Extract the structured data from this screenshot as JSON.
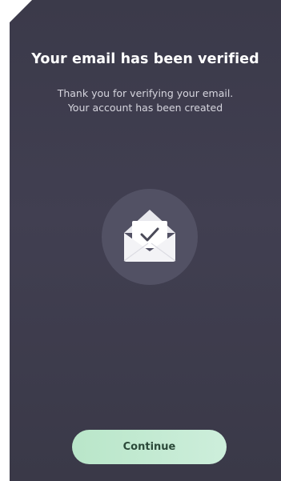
{
  "screen": {
    "title": "Your email has been verified",
    "subtitle_line1": "Thank you for verifying your email.",
    "subtitle_line2": "Your account has been created",
    "icon": "envelope-check-icon",
    "continue_label": "Continue"
  },
  "colors": {
    "background": "#3d3c4c",
    "icon_circle": "#525164",
    "button": "#c3ead2",
    "button_text": "#2c4a3a"
  }
}
